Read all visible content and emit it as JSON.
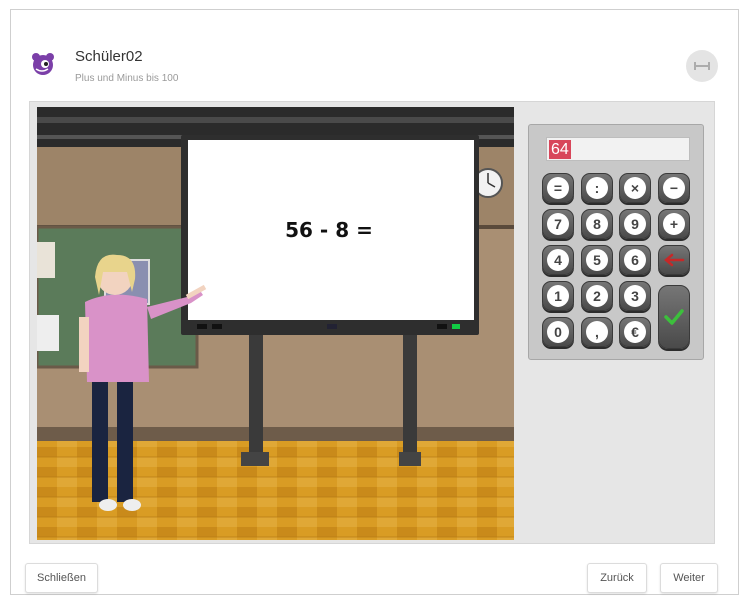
{
  "header": {
    "title": "Schüler02",
    "subtitle": "Plus und Minus bis 100"
  },
  "scene": {
    "equation": "56 - 8 ="
  },
  "calculator": {
    "display_value": "64",
    "keys": {
      "equals": "=",
      "divide": ":",
      "multiply": "×",
      "minus": "−",
      "k7": "7",
      "k8": "8",
      "k9": "9",
      "plus": "+",
      "k4": "4",
      "k5": "5",
      "k6": "6",
      "k1": "1",
      "k2": "2",
      "k3": "3",
      "k0": "0",
      "comma": ",",
      "euro": "€"
    }
  },
  "footer": {
    "close_label": "Schließen",
    "back_label": "Zurück",
    "next_label": "Weiter"
  }
}
